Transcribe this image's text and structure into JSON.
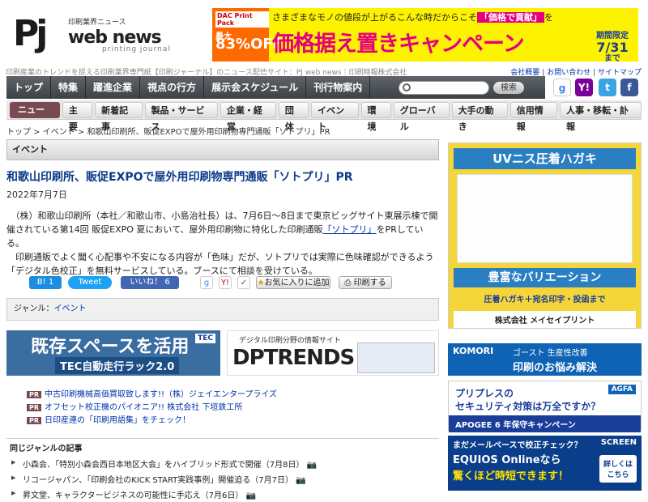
{
  "logo": {
    "pj": "Pj",
    "sub": "印刷業界ニュース",
    "web": "web news",
    "printing": "printing journal"
  },
  "banner": {
    "badge": "DAC Print Pack",
    "discount_label": "最大",
    "discount": "83%OFF",
    "top_text": "さまざまなモノの値段が上がるこんな時だからこそ",
    "top_highlight": "「価格で貢献」",
    "top_tail": "を",
    "headline": "価格据え置きキャンペーン",
    "period_label": "期間限定",
    "period": "7/31",
    "period_tail": "まで"
  },
  "tagline": "印刷産業のトレンドを捉える印刷業界専門紙【印刷ジャーナル】のニュース配信サイト：PJ web news｜印刷時報株式会社",
  "header_links": [
    "会社概要",
    "お問い合わせ",
    "サイトマップ"
  ],
  "nav_main": [
    "トップ",
    "特集",
    "躍進企業",
    "視点の行方",
    "展示会スケジュール",
    "刊行物案内"
  ],
  "search": {
    "placeholder": "",
    "button": "検索"
  },
  "nav_sub": {
    "active": "ニュース",
    "items": [
      "主要",
      "新着記事",
      "製品・サービス",
      "企業・経営",
      "団体",
      "イベント",
      "環境",
      "グローバル",
      "大手の動き",
      "信用情報",
      "人事・移転・訃報"
    ]
  },
  "breadcrumb": "トップ > イベント > 和歌山印刷所、販促EXPOで屋外用印刷物専門通販「ソトプリ」PR",
  "category_header": "イベント",
  "article": {
    "title": "和歌山印刷所、販促EXPOで屋外用印刷物専門通販「ソトプリ」PR",
    "date": "2022年7月7日",
    "p1a": "（株）和歌山印刷所（本社／和歌山市、小島治社長）は、7月6日～8日まで東京ビッグサイト東展示棟で開催されている第14回 販促EXPO 夏において、屋外用印刷物に特化した印刷通販",
    "p1link": "「ソトプリ」",
    "p1b": "をPRしている。",
    "p2": "印刷通販でよく聞く心配事や不安になる内容が「色味」だが、ソトプリでは実際に色味確認ができるよう「デジタル色校正」を無料サービスしている。ブースにて相談を受けている。"
  },
  "share": {
    "hatena": "B! 1",
    "tweet": "Tweet",
    "like": "いいね！ 6",
    "favorite": "お気に入りに追加",
    "print": "印刷する"
  },
  "genre": {
    "label": "ジャンル：",
    "value": "イベント"
  },
  "ads": {
    "a1_title": "既存スペースを活用",
    "a1_sub": "TEC自動走行ラック2.0",
    "a1_brand": "TEC",
    "a2_top": "デジタル印刷分野の情報サイト",
    "a2_main": "DPTRENDS"
  },
  "pr_links": [
    "中古印刷機械高価買取致します!!（株）ジェイエンタープライズ",
    "オフセット校正機のパイオニア!! 株式会社 下垣鉄工所",
    "日印産連の「印刷用語集」をチェック！"
  ],
  "pr_badge": "PR",
  "related": {
    "heading": "同じジャンルの記事",
    "items": [
      "小森会、「特別小森会西日本地区大会」をハイブリッド形式で開催（7月8日）",
      "リコージャパン、「印刷会社のKICK START実践事例」開催迫る（7月7日）",
      "昇文堂、キャラクタービジネスの可能性に手応え（7月6日）"
    ]
  },
  "sidebar": {
    "s1_title": "UVニス圧着ハガキ",
    "s1_mid": "豊富なバリエーション",
    "s1_low": "圧着ハガキ＋宛名印字・投函まで",
    "s1_brand": "株式会社 メイセイプリント",
    "s2_brand": "KOMORI",
    "s2_tags": "ゴースト 生産性改善",
    "s2_main": "印刷のお悩み解決",
    "s3_line1": "プリプレスの",
    "s3_line2": "セキュリティ対策は万全ですか？",
    "s3_brand": "AGFA",
    "s3_foot": "APOGEE 6 年保守キャンペーン",
    "s4_top": "まだメールベースで校正チェック？",
    "s4_brand": "SCREEN",
    "s4_main": "EQUIOS Onlineなら",
    "s4_sub": "驚くほど時短できます！",
    "s4_btn": "詳しくは こちら"
  }
}
